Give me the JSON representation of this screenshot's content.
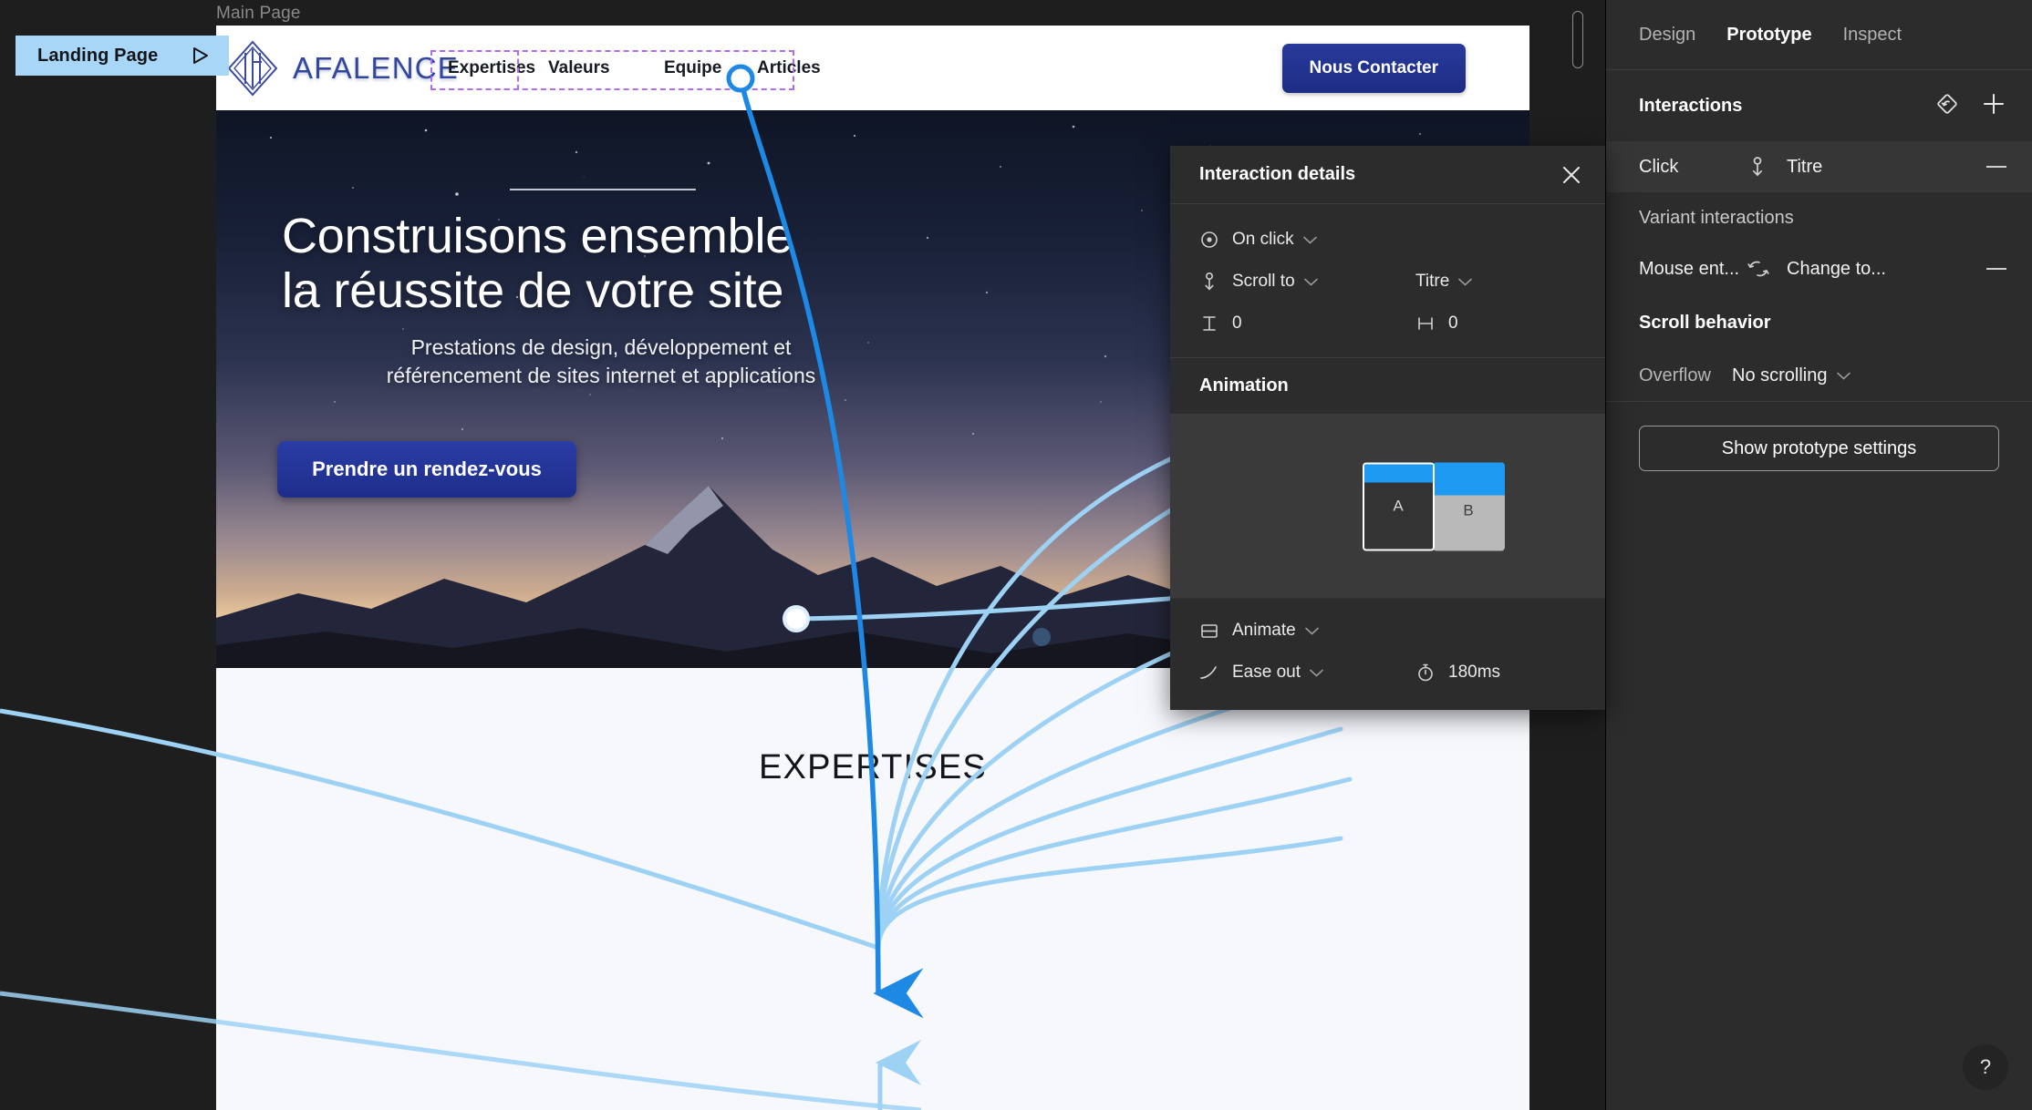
{
  "canvas": {
    "page_label": "Main Page",
    "landing_tab": {
      "label": "Landing Page",
      "play_icon": "play-triangle-icon"
    }
  },
  "site": {
    "logo": {
      "mark": "afalence-diamond-logo-icon",
      "text": "AFALENCE"
    },
    "nav": [
      "Expertises",
      "Valeurs",
      "Equipe",
      "Articles"
    ],
    "contact_button": "Nous Contacter",
    "hero": {
      "title_line1": "Construisons ensemble",
      "title_line2": "la réussite de votre site",
      "subtitle_line1": "Prestations de design, développement et",
      "subtitle_line2": "référencement de sites internet et applications",
      "cta": "Prendre un rendez-vous"
    },
    "section": {
      "title": "EXPERTISES"
    }
  },
  "interaction_details": {
    "title": "Interaction details",
    "close_icon": "close-icon",
    "trigger": {
      "icon": "on-click-icon",
      "label": "On click",
      "chevron": "chevron-down-icon"
    },
    "action": {
      "icon": "scroll-to-anchor-icon",
      "label": "Scroll to",
      "chevron": "chevron-down-icon",
      "target": "Titre",
      "target_chevron": "chevron-down-icon"
    },
    "offsets": {
      "vertical_icon": "vertical-offset-icon",
      "vertical_value": "0",
      "horizontal_icon": "horizontal-offset-icon",
      "horizontal_value": "0"
    },
    "animation": {
      "header": "Animation",
      "preview": {
        "frame_a": "A",
        "frame_b": "B",
        "accent": "#1e9af3"
      },
      "type_icon": "animate-frame-icon",
      "type": "Animate",
      "type_chevron": "chevron-down-icon",
      "easing_icon": "ease-curve-icon",
      "easing": "Ease out",
      "easing_chevron": "chevron-down-icon",
      "duration_icon": "stopwatch-icon",
      "duration": "180ms"
    }
  },
  "sidebar": {
    "tabs": [
      {
        "label": "Design",
        "active": false
      },
      {
        "label": "Prototype",
        "active": true
      },
      {
        "label": "Inspect",
        "active": false
      }
    ],
    "interactions": {
      "header": "Interactions",
      "reset_icon": "prototype-reset-icon",
      "add_icon": "plus-icon",
      "rows": [
        {
          "event": "Click",
          "icon": "scroll-to-anchor-icon",
          "destination": "Titre",
          "remove_icon": "minus-icon"
        }
      ],
      "variant_header": "Variant interactions",
      "variant_rows": [
        {
          "event": "Mouse ent...",
          "icon": "change-to-swap-icon",
          "destination": "Change to...",
          "remove_icon": "minus-icon"
        }
      ]
    },
    "scroll_behavior": {
      "header": "Scroll behavior",
      "overflow_label": "Overflow",
      "overflow_value": "No scrolling",
      "overflow_chevron": "chevron-down-icon"
    },
    "prototype_settings_button": "Show prototype settings",
    "help_button": "?"
  },
  "colors": {
    "accent_blue": "#1e9af3",
    "connector_blue": "#1e88e5",
    "connector_light": "#9ed2f5",
    "selection_purple": "#b06cf0",
    "tab_highlight": "#a8d6f7",
    "brand_navy": "#33469c"
  }
}
